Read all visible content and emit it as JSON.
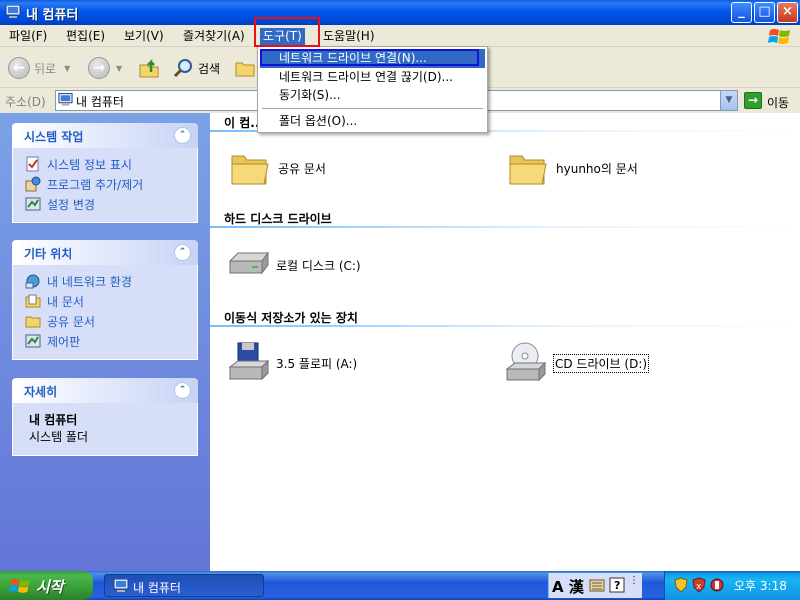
{
  "window": {
    "title": "내 컴퓨터",
    "buttons": {
      "minimize": "_",
      "maximize": "□",
      "close": "×"
    }
  },
  "menubar": {
    "items": [
      "파일(F)",
      "편집(E)",
      "보기(V)",
      "즐겨찾기(A)",
      "도구(T)",
      "도움말(H)"
    ],
    "active": "도구(T)"
  },
  "toolbar": {
    "back_label": "뒤로",
    "search_label": "검색"
  },
  "address": {
    "label": "주소(D)",
    "value": "내 컴퓨터",
    "go_label": "이동"
  },
  "dropdown": {
    "items": [
      "네트워크 드라이브 연결(N)...",
      "네트워크 드라이브 연결 끊기(D)...",
      "동기화(S)...",
      "폴더 옵션(O)..."
    ],
    "highlighted_index": 0
  },
  "left_pane": {
    "system_tasks": {
      "title": "시스템 작업",
      "links": [
        "시스템 정보 표시",
        "프로그램 추가/제거",
        "설정 변경"
      ]
    },
    "other_places": {
      "title": "기타 위치",
      "links": [
        "내 네트워크 환경",
        "내 문서",
        "공유 문서",
        "제어판"
      ]
    },
    "details": {
      "title": "자세히",
      "name": "내 컴퓨터",
      "type": "시스템 폴더"
    }
  },
  "right_pane": {
    "group1_header": "이 컴...",
    "group1_items": [
      "공유 문서",
      "hyunho의 문서"
    ],
    "group2_header": "하드 디스크 드라이브",
    "group2_items": [
      "로컬 디스크 (C:)"
    ],
    "group3_header": "이동식 저장소가 있는 장치",
    "group3_items": [
      "3.5 플로피 (A:)",
      "CD 드라이브 (D:)"
    ]
  },
  "taskbar": {
    "start_label": "시작",
    "task_item": "내 컴퓨터",
    "lang_ime": "A 漢",
    "clock": "오후 3:18"
  },
  "colors": {
    "highlight": "#316AC5",
    "link": "#215DC6",
    "annotation_red": "#E81010",
    "annotation_blue": "#1010E0"
  }
}
